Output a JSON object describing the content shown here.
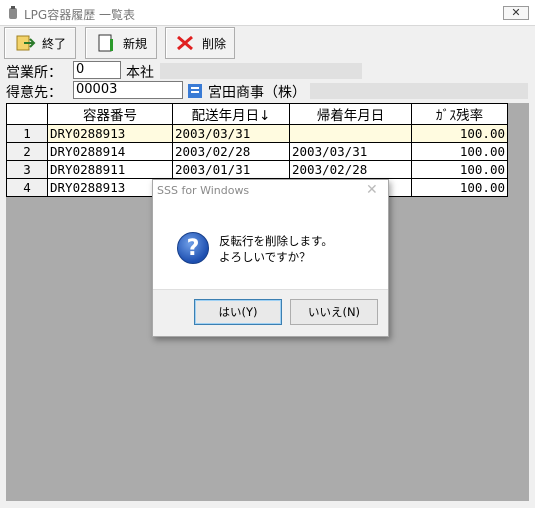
{
  "window": {
    "title": "LPG容器履歴 一覧表",
    "close_label": "✕"
  },
  "toolbar": {
    "exit_label": "終了",
    "new_label": "新規",
    "delete_label": "削除"
  },
  "office": {
    "label": "営業所：",
    "code": "0",
    "name": "本社"
  },
  "customer": {
    "label": "得意先：",
    "code": "00003",
    "name": "宮田商事（株）"
  },
  "grid": {
    "headers": [
      "容器番号",
      "配送年月日↓",
      "帰着年月日",
      "ｶﾞｽ残率"
    ],
    "rows": [
      {
        "no": "1",
        "container": "DRY0288913",
        "delivery": "2003/03/31",
        "return": "",
        "gas": "100.00"
      },
      {
        "no": "2",
        "container": "DRY0288914",
        "delivery": "2003/02/28",
        "return": "2003/03/31",
        "gas": "100.00"
      },
      {
        "no": "3",
        "container": "DRY0288911",
        "delivery": "2003/01/31",
        "return": "2003/02/28",
        "gas": "100.00"
      },
      {
        "no": "4",
        "container": "DRY0288913",
        "delivery": "",
        "return": "",
        "gas": "100.00"
      }
    ]
  },
  "dialog": {
    "title": "SSS for Windows",
    "close_label": "✕",
    "line1": "反転行を削除します。",
    "line2": "よろしいですか？",
    "yes_label": "はい(Y)",
    "no_label": "いいえ(N)",
    "icon_glyph": "?"
  }
}
